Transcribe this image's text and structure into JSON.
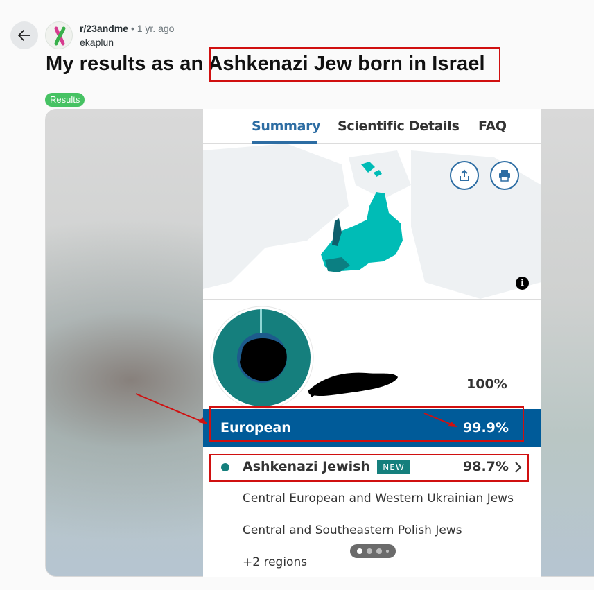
{
  "post": {
    "subreddit": "r/23andme",
    "separator": "•",
    "time_ago": "1 yr. ago",
    "author": "ekaplun",
    "title_prefix": "My results as an",
    "title_highlight": "Ashkenazi Jew born in Israel",
    "flair": "Results"
  },
  "screenshot": {
    "tabs": [
      {
        "label": "Summary",
        "active": true
      },
      {
        "label": "Scientific Details",
        "active": false
      },
      {
        "label": "FAQ",
        "active": false
      }
    ],
    "icons": [
      "share-icon",
      "print-icon",
      "info-icon"
    ],
    "total_percent": "100%",
    "top_region": {
      "label": "European",
      "percent": "99.9%"
    },
    "population": {
      "label": "Ashkenazi Jewish",
      "badge": "NEW",
      "percent": "98.7%"
    },
    "sub_regions": [
      "Central European and Western Ukrainian Jews",
      "Central and Southeastern Polish Jews",
      "+2 regions"
    ],
    "carousel": {
      "pages": 4,
      "current": 1
    }
  },
  "colors": {
    "accent_blue": "#2d6da3",
    "european_bar": "#005b99",
    "ashkenazi_teal": "#157f7d",
    "flair_green": "#46c263",
    "annotation_red": "#d01010"
  }
}
